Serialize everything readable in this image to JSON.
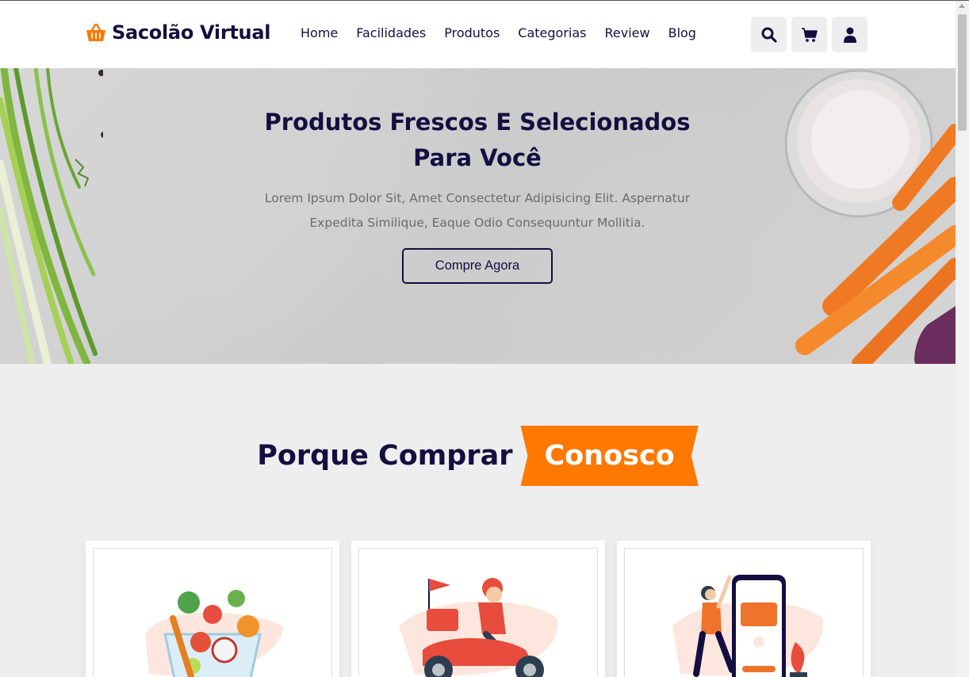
{
  "brand": {
    "name": "Sacolão Virtual",
    "icon": "basket-icon",
    "accent": "#ff7800",
    "dark": "#130f40"
  },
  "nav": {
    "items": [
      "Home",
      "Facilidades",
      "Produtos",
      "Categorias",
      "Review",
      "Blog"
    ]
  },
  "header_icons": [
    "search-icon",
    "cart-icon",
    "user-icon"
  ],
  "hero": {
    "title": "Produtos Frescos E Selecionados Para Você",
    "description": "Lorem Ipsum Dolor Sit, Amet Consectetur Adipisicing Elit. Aspernatur Expedita Similique, Eaque Odio Consequuntur Mollitia.",
    "button": "Compre Agora"
  },
  "features": {
    "heading_main": "Porque Comprar",
    "heading_accent": "Conosco",
    "cards": [
      {
        "image": "fresh-vegetables-illustration"
      },
      {
        "image": "delivery-scooter-illustration"
      },
      {
        "image": "mobile-payment-illustration"
      }
    ]
  }
}
